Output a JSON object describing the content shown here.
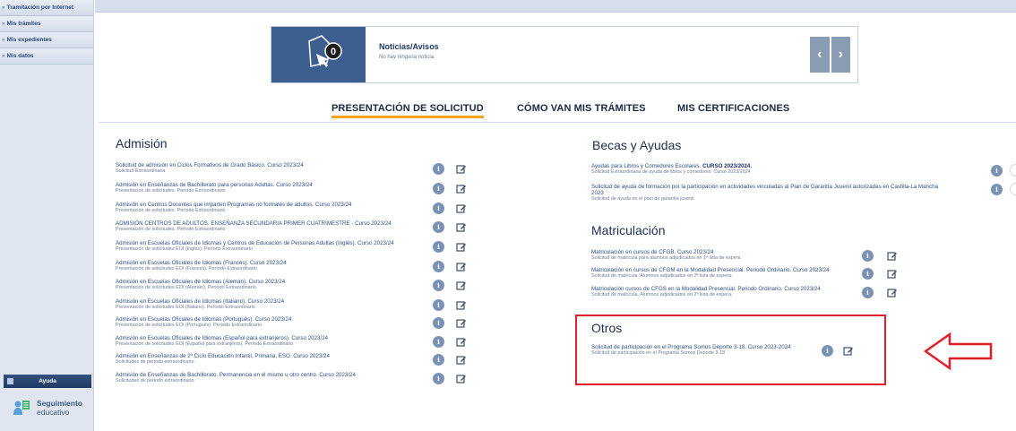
{
  "sidebar": {
    "items": [
      {
        "label": "Tramitación por Internet"
      },
      {
        "label": "Mis trámites"
      },
      {
        "label": "Mis expedientes"
      },
      {
        "label": "Mis datos"
      }
    ],
    "ayuda_label": "Ayuda",
    "seguimiento_line1": "Seguimiento",
    "seguimiento_line2": "educativo"
  },
  "news": {
    "count": "0",
    "title": "Noticias/Avisos",
    "subtitle": "No hay ninguna noticia.",
    "prev": "‹",
    "next": "›"
  },
  "tabs": [
    {
      "label": "PRESENTACIÓN DE SOLICITUD",
      "active": true
    },
    {
      "label": "CÓMO VAN MIS TRÁMITES",
      "active": false
    },
    {
      "label": "MIS CERTIFICACIONES",
      "active": false
    }
  ],
  "admision": {
    "title": "Admisión",
    "items": [
      {
        "title": "Solicitud de admisión en Ciclos Formativos de Grado Básico. Curso 2023/24",
        "sub": "Solicitud Extraordinaria"
      },
      {
        "title": "Admisión en Enseñanzas de Bachillerato para personas Adultas. Curso 2023/24",
        "sub": "Presentación de solicitudes. Período Extraordinario"
      },
      {
        "title": "Admisión en Centros Docentes que imparten Programas no formales de adultos. Curso 2023/24",
        "sub": "Presentación de solicitudes. Período Extraordinario"
      },
      {
        "title": "ADMISIÓN CENTROS DE ADULTOS. ENSEÑANZA SECUNDARIA PRIMER CUATRIMESTRE - Curso 2023/24",
        "sub": "Presentación de solicitudes. Período Extraordinario"
      },
      {
        "title": "Admisión en Escuelas Oficiales de Idiomas y Centros de Educación de Personas Adultas (Inglés). Curso 2023/24",
        "sub": "Presentación de solicitudes EOI (Inglés). Período Extraordinario"
      },
      {
        "title": "Admisión en Escuelas Oficiales de Idiomas (Francés). Curso 2023/24",
        "sub": "Presentación de solicitudes EOI (Francés). Período Extraordinario"
      },
      {
        "title": "Admisión en Escuelas Oficiales de Idiomas (Alemán). Curso 2023/24",
        "sub": "Presentación de solicitudes EOI (Alemán). Período Extraordinario"
      },
      {
        "title": "Admisión en Escuelas Oficiales de Idiomas (Italiano). Curso 2023/24",
        "sub": "Presentación de solicitudes EOI (Italiano). Período Extraordinario"
      },
      {
        "title": "Admisión en Escuelas Oficiales de Idiomas (Portugués). Curso 2023/24",
        "sub": "Presentación de solicitudes EOI (Portugués). Período Extraordinario"
      },
      {
        "title": "Admisión en Escuelas Oficiales de Idiomas (Español para extranjeros). Curso 2023/24",
        "sub": "Presentación de solicitudes EOI (Español para extranjeros). Período Extraordinario"
      },
      {
        "title": "Admisión en Enseñanzas de 2º Ciclo Educación Infantil, Primaria, ESO. Curso 2023/24",
        "sub": "Solicitudes de periodo extraordinario"
      },
      {
        "title": "Admisión de Enseñanzas de Bachillerato. Permanencia en el mismo u otro centro. Curso 2023/24",
        "sub": "Solicitudes de periodo extraordinario"
      }
    ]
  },
  "becas": {
    "title": "Becas y Ayudas",
    "items": [
      {
        "title": "Ayudas para Libros y Comedores Escolares.",
        "title_bold": "CURSO 2023/2024.",
        "sub": "Solicitud Extraordinaria de ayuda de libros y comedores. Curso 2023/2024"
      },
      {
        "title": "Solicitud de ayuda de formación por la participación en actividades vinculadas al Plan de Garantía Juvenil autorizadas en Castilla-La Mancha",
        "title2": "2023",
        "sub": "Solicitud de ayuda en el plan de garantía juvenil"
      }
    ]
  },
  "matriculacion": {
    "title": "Matriculación",
    "items": [
      {
        "title": "Matriculación en cursos de CFGB. Curso 2023/24",
        "sub": "Solicitud de matrícula para alumnos adjudicados en 1ª lista de espera"
      },
      {
        "title": "Matriculación en cursos de CFGM en la Modalidad Presencial. Periodo Ordinario. Curso 2023/24",
        "sub": "Solicitud de matrícula. Alumnos adjudicados en 2ª lista de espera."
      },
      {
        "title": "Matriculación cursos de CFGS en la Modalidad Presencial. Periodo Ordinario. Curso 2023/24",
        "sub": "Solicitud de matrícula. Alumnos adjudicados en 2ª lista de espera."
      }
    ]
  },
  "otros": {
    "title": "Otros",
    "items": [
      {
        "title": "Solicitud de participación en el Programa Somos Deporte 3-18. Curso 2023-2024",
        "sub": "Solicitud de participación en el Programa Somos Deporte 3-18"
      }
    ]
  },
  "colors": {
    "accent": "#f2a31b",
    "highlight": "#e0202a",
    "nav": "#3d5f8f"
  }
}
